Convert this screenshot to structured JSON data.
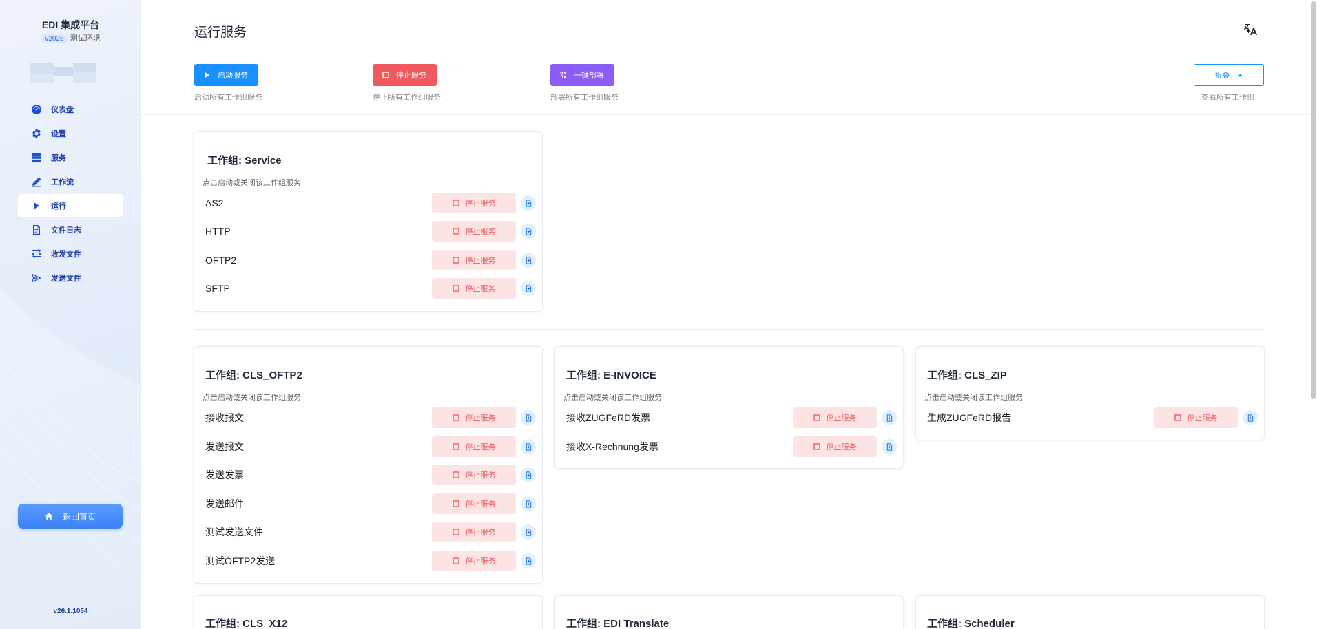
{
  "app": {
    "title": "EDI 集成平台",
    "version_badge": "v2026",
    "env_label": "测试环境",
    "app_version": "v26.1.1054",
    "home_label": "返回首页"
  },
  "sidebar": {
    "items": [
      {
        "label": "仪表盘",
        "icon": "dashboard-icon",
        "active": false
      },
      {
        "label": "设置",
        "icon": "gear-icon",
        "active": false
      },
      {
        "label": "服务",
        "icon": "server-icon",
        "active": false
      },
      {
        "label": "工作流",
        "icon": "pencil-icon",
        "active": false
      },
      {
        "label": "运行",
        "icon": "play-icon",
        "active": true
      },
      {
        "label": "文件日志",
        "icon": "file-log-icon",
        "active": false
      },
      {
        "label": "收发文件",
        "icon": "transfer-icon",
        "active": false
      },
      {
        "label": "发送文件",
        "icon": "send-icon",
        "active": false
      }
    ]
  },
  "header": {
    "title": "运行服务"
  },
  "actions": {
    "start_label": "启动服务",
    "start_desc": "启动所有工作组服务",
    "stop_label": "停止服务",
    "stop_desc": "停止所有工作组服务",
    "deploy_label": "一键部署",
    "deploy_desc": "部署所有工作组服务",
    "collapse_label": "折叠",
    "collapse_desc": "查看所有工作组"
  },
  "colors": {
    "primary": "#1890ff",
    "danger": "#f05a5e",
    "danger_bg": "#fde4e4",
    "purple": "#8b5cf6"
  },
  "groups": [
    {
      "title": "工作组: Service",
      "desc": "点击启动或关闭该工作组服务",
      "services": [
        {
          "name": "AS2",
          "button": "停止服务"
        },
        {
          "name": "HTTP",
          "button": "停止服务"
        },
        {
          "name": "OFTP2",
          "button": "停止服务"
        },
        {
          "name": "SFTP",
          "button": "停止服务"
        }
      ]
    },
    {
      "title": "工作组: CLS_OFTP2",
      "desc": "点击启动或关闭该工作组服务",
      "services": [
        {
          "name": "接收报文",
          "button": "停止服务"
        },
        {
          "name": "发送报文",
          "button": "停止服务"
        },
        {
          "name": "发送发票",
          "button": "停止服务"
        },
        {
          "name": "发送邮件",
          "button": "停止服务"
        },
        {
          "name": "测试发送文件",
          "button": "停止服务"
        },
        {
          "name": "测试OFTP2发送",
          "button": "停止服务"
        }
      ]
    },
    {
      "title": "工作组: E-INVOICE",
      "desc": "点击启动或关闭该工作组服务",
      "services": [
        {
          "name": "接收ZUGFeRD发票",
          "button": "停止服务"
        },
        {
          "name": "接收X-Rechnung发票",
          "button": "停止服务"
        }
      ]
    },
    {
      "title": "工作组: CLS_ZIP",
      "desc": "点击启动或关闭该工作组服务",
      "services": [
        {
          "name": "生成ZUGFeRD报告",
          "button": "停止服务"
        }
      ]
    },
    {
      "title": "工作组: CLS_X12",
      "desc": "",
      "services": []
    },
    {
      "title": "工作组: EDI Translate",
      "desc": "",
      "services": []
    },
    {
      "title": "工作组: Scheduler",
      "desc": "",
      "services": []
    }
  ]
}
